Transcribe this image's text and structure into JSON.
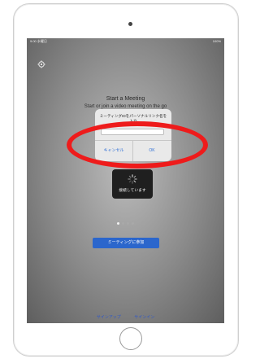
{
  "status_bar": {
    "left": "9:00 水曜日",
    "right": "100%"
  },
  "main": {
    "title": "Start a Meeting",
    "subtitle": "Start or join a video meeting on the go"
  },
  "alert": {
    "message": "ミーティングIDをパーソナルリンク名を入力",
    "input_value": "",
    "cancel_label": "キャンセル",
    "ok_label": "OK"
  },
  "toast": {
    "text": "接続しています"
  },
  "join_button_label": "ミーティングに参加",
  "bottom_links": {
    "sign_up": "サインアップ",
    "sign_in": "サインイン"
  },
  "page_indicator": {
    "count": 4,
    "active_index": 0
  },
  "colors": {
    "annotation": "#ee1b1b",
    "accent": "#2b66cc",
    "link": "#2f58c8"
  },
  "icons": [
    "settings-icon",
    "spinner-icon"
  ]
}
